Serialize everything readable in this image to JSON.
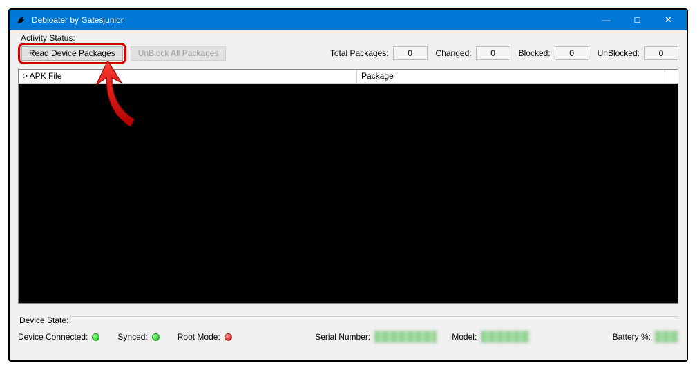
{
  "window": {
    "title": "Debloater by Gatesjunior"
  },
  "activity": {
    "label": "Activity Status:",
    "read_btn": "Read Device Packages",
    "unblock_btn": "UnBlock All Packages",
    "stats": {
      "total_label": "Total Packages:",
      "total_value": "0",
      "changed_label": "Changed:",
      "changed_value": "0",
      "blocked_label": "Blocked:",
      "blocked_value": "0",
      "unblocked_label": "UnBlocked:",
      "unblocked_value": "0"
    }
  },
  "table": {
    "col1": "> APK File",
    "col2": "Package"
  },
  "device": {
    "label": "Device State:",
    "connected_label": "Device Connected:",
    "synced_label": "Synced:",
    "root_label": "Root Mode:",
    "serial_label": "Serial Number:",
    "model_label": "Model:",
    "battery_label": "Battery %:"
  }
}
